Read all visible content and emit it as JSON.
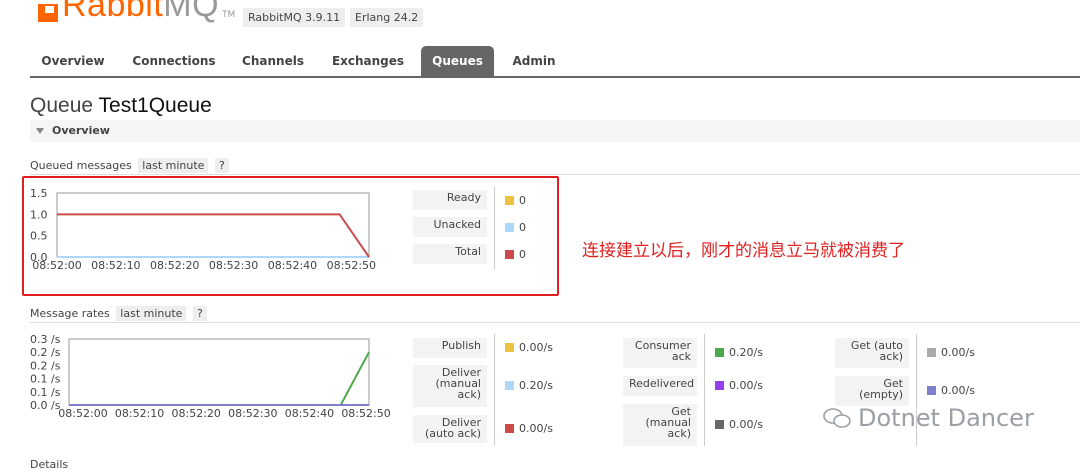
{
  "header": {
    "logo_text_a": "Rabbit",
    "logo_text_b": "MQ",
    "logo_tm": "TM",
    "rabbitmq_version": "RabbitMQ 3.9.11",
    "erlang_version": "Erlang 24.2"
  },
  "tabs": [
    {
      "label": "Overview"
    },
    {
      "label": "Connections"
    },
    {
      "label": "Channels"
    },
    {
      "label": "Exchanges"
    },
    {
      "label": "Queues",
      "active": true
    },
    {
      "label": "Admin"
    }
  ],
  "page": {
    "title_prefix": "Queue",
    "queue_name": "Test1Queue",
    "section_label": "Overview",
    "details_label": "Details"
  },
  "queued_messages": {
    "label": "Queued messages",
    "range": "last minute",
    "help": "?",
    "legend": [
      {
        "label": "Ready",
        "value": "0",
        "color": "#edc240"
      },
      {
        "label": "Unacked",
        "value": "0",
        "color": "#afd8f8"
      },
      {
        "label": "Total",
        "value": "0",
        "color": "#cb4b4b"
      }
    ]
  },
  "message_rates": {
    "label": "Message rates",
    "range": "last minute",
    "help": "?",
    "legend_col1": [
      {
        "label_lines": [
          "Publish"
        ],
        "value": "0.00/s",
        "color": "#edc240"
      },
      {
        "label_lines": [
          "Deliver",
          "(manual",
          "ack)"
        ],
        "value": "0.20/s",
        "color": "#afd8f8"
      },
      {
        "label_lines": [
          "Deliver",
          "(auto ack)"
        ],
        "value": "0.00/s",
        "color": "#cb4b4b"
      }
    ],
    "legend_col2": [
      {
        "label_lines": [
          "Consumer",
          "ack"
        ],
        "value": "0.20/s",
        "color": "#4da74d"
      },
      {
        "label_lines": [
          "Redelivered"
        ],
        "value": "0.00/s",
        "color": "#9440ed"
      },
      {
        "label_lines": [
          "Get",
          "(manual",
          "ack)"
        ],
        "value": "0.00/s",
        "color": "#666666"
      }
    ],
    "legend_col3": [
      {
        "label_lines": [
          "Get (auto",
          "ack)"
        ],
        "value": "0.00/s",
        "color": "#aaaaaa"
      },
      {
        "label_lines": [
          "Get",
          "(empty)"
        ],
        "value": "0.00/s",
        "color": "#7f7fcc"
      }
    ]
  },
  "annotation": "连接建立以后，刚才的消息立马就被消费了",
  "watermark": "Dotnet Dancer",
  "chart_data": [
    {
      "type": "line",
      "title": "Queued messages",
      "x": [
        "08:52:00",
        "08:52:10",
        "08:52:20",
        "08:52:30",
        "08:52:40",
        "08:52:50"
      ],
      "y_ticks": [
        "0.0",
        "0.5",
        "1.0",
        "1.5"
      ],
      "ylim": [
        0,
        1.5
      ],
      "xlim_seconds": [
        0,
        53
      ],
      "series": [
        {
          "name": "Ready",
          "color": "#edc240",
          "points": [
            [
              0,
              0
            ],
            [
              53,
              0
            ]
          ]
        },
        {
          "name": "Unacked",
          "color": "#afd8f8",
          "points": [
            [
              0,
              0
            ],
            [
              53,
              0
            ]
          ]
        },
        {
          "name": "Total",
          "color": "#cb4b4b",
          "points": [
            [
              0,
              1
            ],
            [
              48,
              1
            ],
            [
              53,
              0
            ]
          ]
        }
      ]
    },
    {
      "type": "line",
      "title": "Message rates",
      "x": [
        "08:52:00",
        "08:52:10",
        "08:52:20",
        "08:52:30",
        "08:52:40",
        "08:52:50"
      ],
      "y_ticks": [
        "0.0 /s",
        "0.1 /s",
        "0.1 /s",
        "0.2 /s",
        "0.2 /s",
        "0.3 /s"
      ],
      "ylim": [
        0,
        0.25
      ],
      "xlim_seconds": [
        0,
        53
      ],
      "series": [
        {
          "name": "Consumer ack",
          "color": "#4da74d",
          "points": [
            [
              0,
              0
            ],
            [
              48,
              0
            ],
            [
              53,
              0.2
            ]
          ]
        },
        {
          "name": "Deliver (manual ack)",
          "color": "#afd8f8",
          "points": [
            [
              0,
              0
            ],
            [
              53,
              0
            ]
          ]
        },
        {
          "name": "Get (empty)",
          "color": "#7f7fcc",
          "points": [
            [
              0,
              0
            ],
            [
              53,
              0
            ]
          ]
        }
      ]
    }
  ]
}
